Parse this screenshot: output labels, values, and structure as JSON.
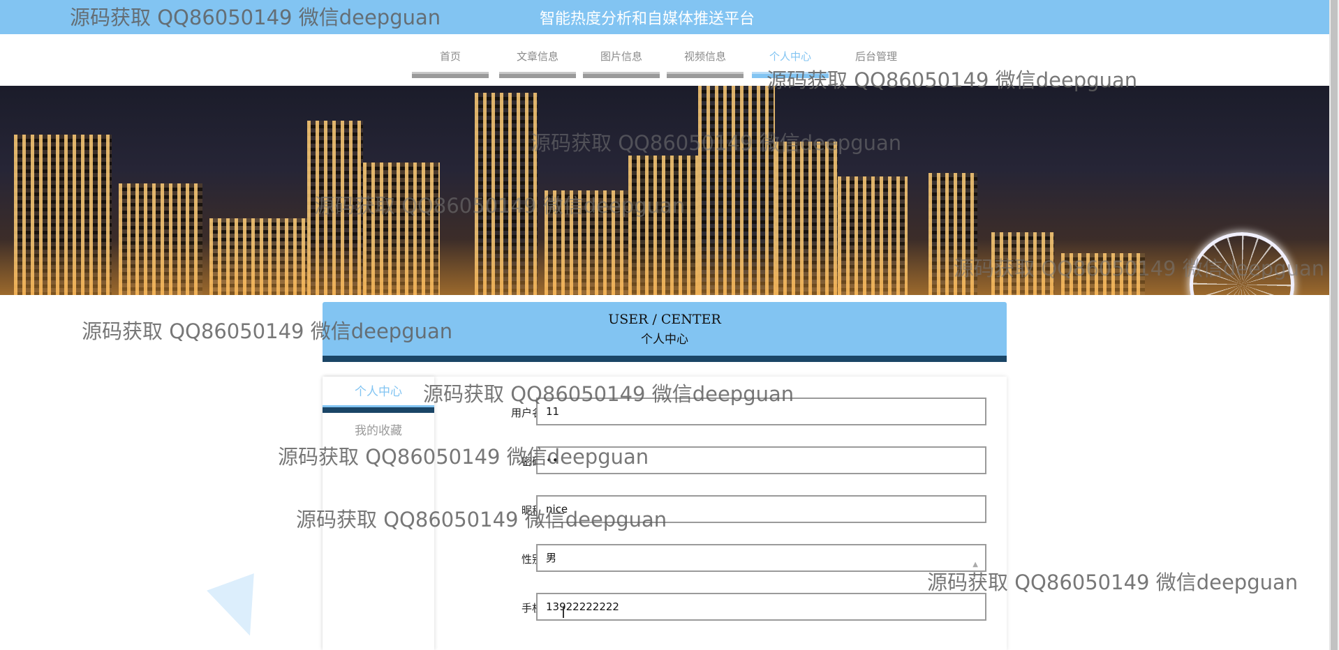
{
  "header": {
    "site_title": "智能热度分析和自媒体推送平台"
  },
  "nav": {
    "items": [
      {
        "label": "首页"
      },
      {
        "label": "文章信息"
      },
      {
        "label": "图片信息"
      },
      {
        "label": "视频信息"
      },
      {
        "label": "个人中心",
        "active": true
      },
      {
        "label": "后台管理"
      }
    ]
  },
  "user_center": {
    "title_en": "USER / CENTER",
    "title_cn": "个人中心"
  },
  "sidebar": {
    "items": [
      {
        "label": "个人中心",
        "active": true
      },
      {
        "label": "我的收藏"
      }
    ]
  },
  "form": {
    "username": {
      "label": "用户名",
      "value": "11"
    },
    "password": {
      "label": "密码",
      "value": "••"
    },
    "nickname": {
      "label": "昵称",
      "value": "nice"
    },
    "gender": {
      "label": "性别",
      "value": "男"
    },
    "phone": {
      "label": "手机",
      "value": "13922222222"
    }
  },
  "watermark": {
    "text": "源码获取 QQ86050149 微信deepguan"
  },
  "colors": {
    "accent": "#82c4f2",
    "dark_accent": "#1a4566",
    "nav_inactive": "#9a9a9a"
  }
}
